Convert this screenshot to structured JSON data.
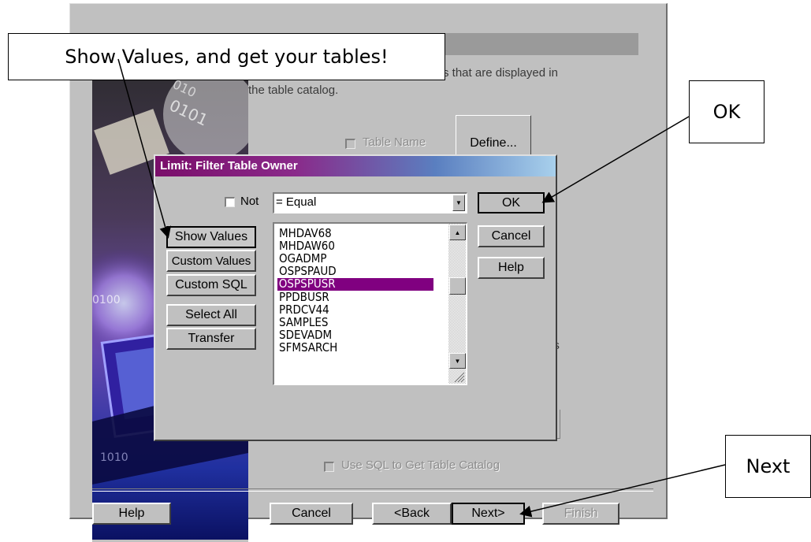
{
  "wizard": {
    "description_visible_1": "s that are displayed in",
    "description_visible_2": "the table catalog.",
    "table_name_label": "Table Name",
    "define_button": "Define...",
    "ns_fragment": "ns",
    "use_sql_label": "Use SQL to Get Table Catalog",
    "footer": {
      "help": "Help",
      "cancel": "Cancel",
      "back": "<Back",
      "next": "Next>",
      "finish": "Finish"
    }
  },
  "dialog": {
    "title": "Limit: Filter Table Owner",
    "not_label": "Not",
    "operator_value": "= Equal",
    "side_buttons": {
      "show_values": "Show Values",
      "custom_values": "Custom Values",
      "custom_sql": "Custom SQL",
      "select_all": "Select All",
      "transfer": "Transfer"
    },
    "right_buttons": {
      "ok": "OK",
      "cancel": "Cancel",
      "help": "Help"
    },
    "list_items": [
      "MHDAV68",
      "MHDAW60",
      "OGADMP",
      "OSPSPAUD",
      "OSPSPUSR",
      "PPDBUSR",
      "PRDCV44",
      "SAMPLES",
      "SDEVADM",
      "SFMSARCH"
    ],
    "selected_item": "OSPSPUSR"
  },
  "callouts": {
    "show_values": "Show Values, and get your tables!",
    "ok": "OK",
    "next": "Next"
  },
  "colors": {
    "selection": "#800080",
    "window": "#c0c0c0"
  }
}
